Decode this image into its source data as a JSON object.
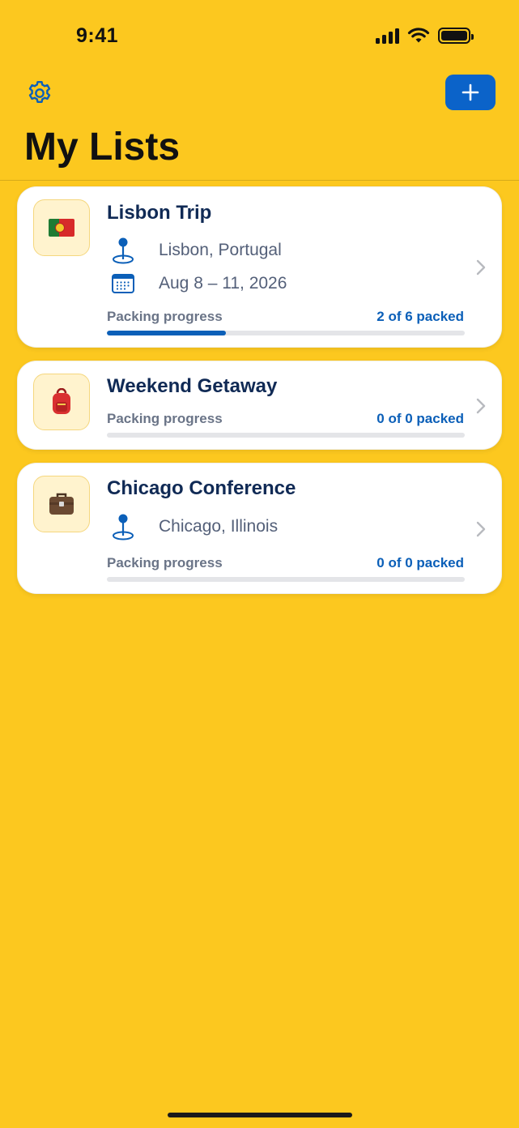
{
  "status_bar": {
    "time": "9:41",
    "icons": [
      "cellular-signal-icon",
      "wifi-icon",
      "battery-icon"
    ]
  },
  "header": {
    "settings_icon": "gear-icon",
    "add_icon": "plus-icon",
    "title": "My Lists"
  },
  "colors": {
    "background": "#FCC81F",
    "accent": "#0B63C9",
    "title_text": "#102A55"
  },
  "lists": [
    {
      "icon": "portugal-flag-icon",
      "title": "Lisbon Trip",
      "location": "Lisbon, Portugal",
      "dates": "Aug 8 – 11, 2026",
      "progress_label": "Packing progress",
      "progress_text": "2 of 6 packed",
      "packed": 2,
      "total": 6
    },
    {
      "icon": "backpack-icon",
      "title": "Weekend Getaway",
      "progress_label": "Packing progress",
      "progress_text": "0 of 0 packed",
      "packed": 0,
      "total": 0
    },
    {
      "icon": "briefcase-icon",
      "title": "Chicago Conference",
      "location": "Chicago, Illinois",
      "progress_label": "Packing progress",
      "progress_text": "0 of 0 packed",
      "packed": 0,
      "total": 0
    }
  ]
}
